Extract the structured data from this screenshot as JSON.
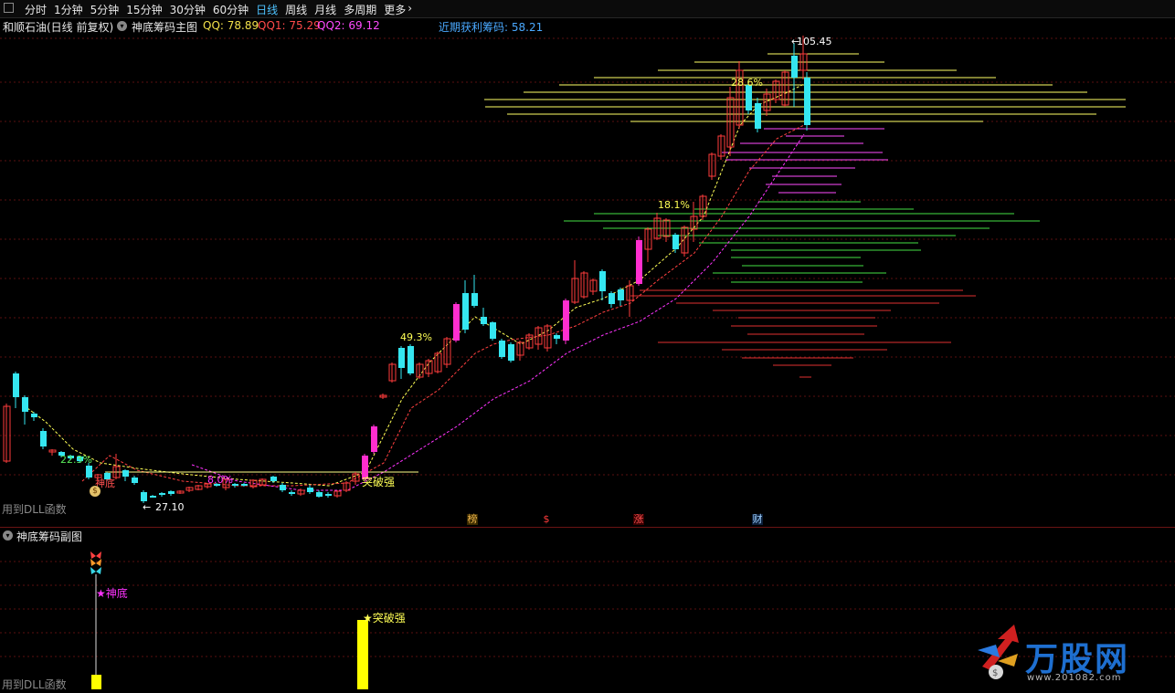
{
  "toolbar": {
    "tabs": [
      "分时",
      "1分钟",
      "5分钟",
      "15分钟",
      "30分钟",
      "60分钟",
      "日线",
      "周线",
      "月线",
      "多周期",
      "更多"
    ],
    "active_tab": "日线",
    "more_arrow": "›"
  },
  "info": {
    "title": "和顺石油(日线 前复权)",
    "indicator_name": "神底筹码主图",
    "qq_label": "QQ: 78.89",
    "qq1_label": "QQ1: 75.29",
    "qq2_label": "QQ2: 69.12",
    "recent_profit_label": "近期获利筹码: 58.21"
  },
  "colors": {
    "up": "#ff3c3c",
    "down": "#35e6f0",
    "boom": "#ff2ecf",
    "yellow": "#ffff33",
    "magenta": "#ff33ff",
    "grid": "#5a0f0f"
  },
  "main_labels": {
    "high_price": "105.45",
    "low_price": "27.10",
    "pct_1": "22.3%",
    "pct_2": "8.0%",
    "pct_3": "49.3%",
    "pct_4": "18.1%",
    "pct_5": "28.6%",
    "shendi": "神底",
    "breakout": "突破强",
    "dll_text": "用到DLL函数"
  },
  "events": [
    "榜",
    "$",
    "涨",
    "财"
  ],
  "sub": {
    "title": "神底筹码副图",
    "shendi_label": "★神底",
    "breakout_label": "★突破强",
    "dll_text": "用到DLL函数"
  },
  "watermark": {
    "brand": "万股网",
    "site": "www.201082.com"
  }
}
